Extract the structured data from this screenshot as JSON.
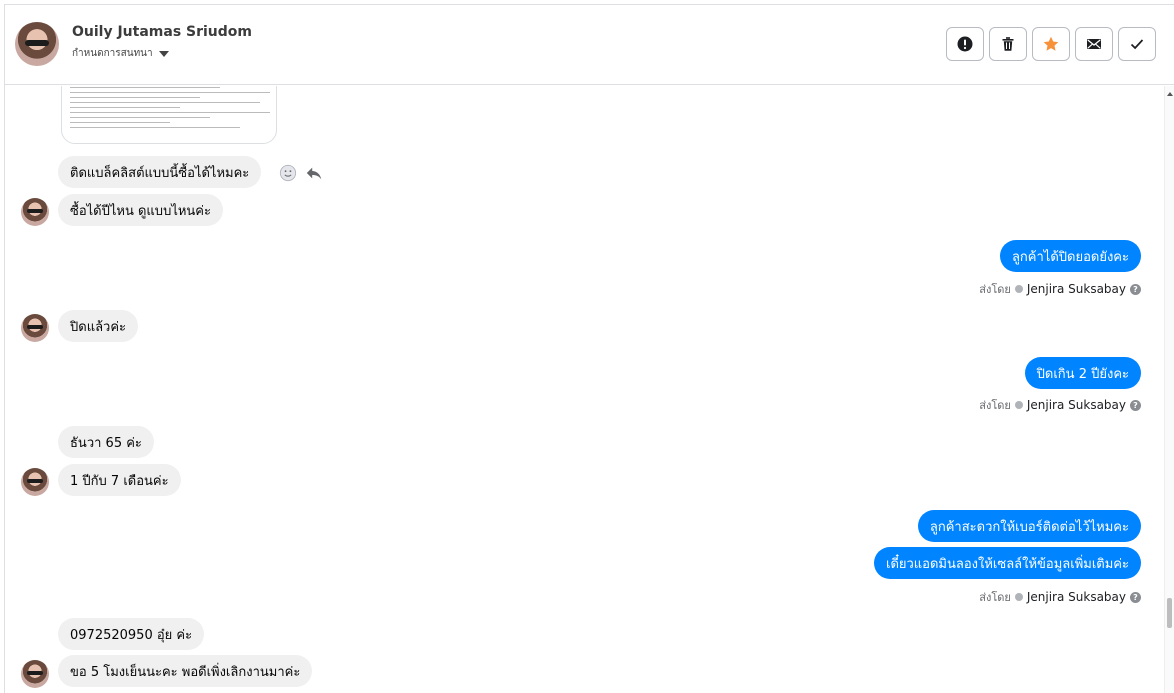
{
  "header": {
    "contact_name": "Ouily Jutamas Sriudom",
    "assign_label": "กำหนดการสนทนา",
    "actions": [
      {
        "name": "report",
        "icon": "exclamation-circle-icon"
      },
      {
        "name": "delete",
        "icon": "trash-icon"
      },
      {
        "name": "star",
        "icon": "star-icon",
        "color": "#f7923a"
      },
      {
        "name": "mail",
        "icon": "envelope-icon"
      },
      {
        "name": "done",
        "icon": "check-icon"
      }
    ]
  },
  "messages": [
    {
      "dir": "in",
      "text": "ติดแบล็คลิสต์แบบนี้ซื้อได้ไหมคะ"
    },
    {
      "dir": "in",
      "text": "ซื้อได้ปีไหน ดูแบบไหนค่ะ"
    },
    {
      "dir": "out",
      "text": "ลูกค้าได้ปิดยอดยังคะ"
    },
    {
      "dir": "in",
      "text": "ปิดแล้วค่ะ"
    },
    {
      "dir": "out",
      "text": "ปิดเกิน 2 ปียังคะ"
    },
    {
      "dir": "in",
      "text": "ธันวา 65 ค่ะ"
    },
    {
      "dir": "in",
      "text": "1 ปีกับ 7 เดือนค่ะ"
    },
    {
      "dir": "out",
      "text": "ลูกค้าสะดวกให้เบอร์ติดต่อไว้ไหมคะ"
    },
    {
      "dir": "out",
      "text": "เดี๋ยวแอดมินลองให้เซลล์ให้ข้อมูลเพิ่มเติมค่ะ"
    },
    {
      "dir": "in",
      "text": "0972520950 อุ๋ย ค่ะ"
    },
    {
      "dir": "in",
      "text": "ขอ 5 โมงเย็นนะคะ พอดีเพิ่งเลิกงานมาค่ะ"
    }
  ],
  "sent_by": {
    "label": "ส่งโดย",
    "agent": "Jenjira Suksabay"
  },
  "colors": {
    "outgoing_bubble": "#0084ff",
    "incoming_bubble": "#f0f0f0",
    "star": "#f7923a"
  }
}
